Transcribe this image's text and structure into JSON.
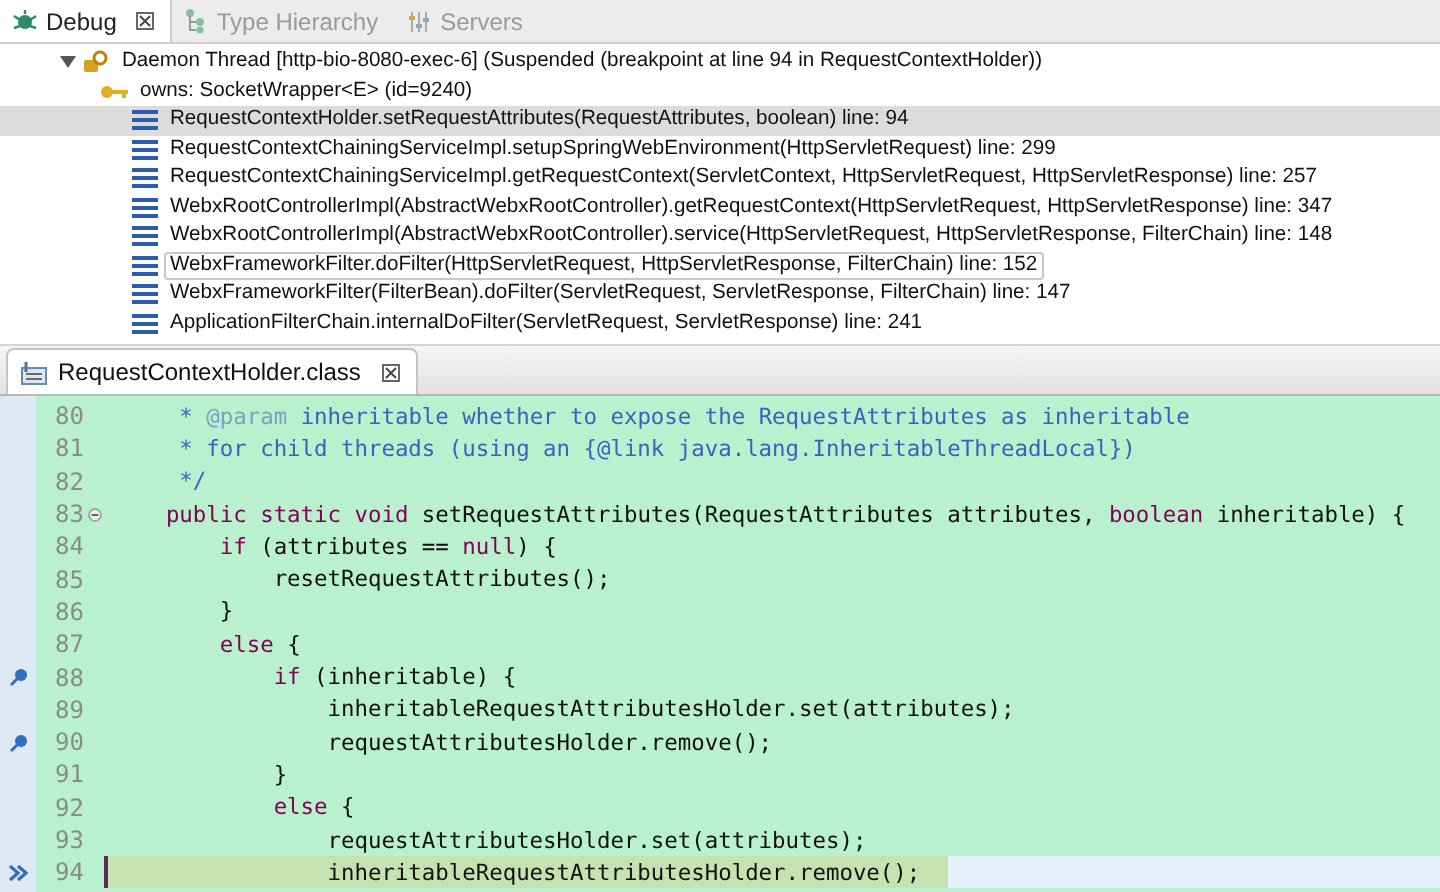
{
  "view_tabs": [
    {
      "label": "Debug",
      "selected": true,
      "closable": true
    },
    {
      "label": "Type Hierarchy",
      "selected": false,
      "closable": false
    },
    {
      "label": "Servers",
      "selected": false,
      "closable": false
    }
  ],
  "debug_tree": {
    "thread": {
      "label": "Daemon Thread [http-bio-8080-exec-6] (Suspended (breakpoint at line 94 in RequestContextHolder))",
      "expanded": true
    },
    "monitor": {
      "label": "owns: SocketWrapper<E>  (id=9240)"
    },
    "frames": [
      {
        "label": "RequestContextHolder.setRequestAttributes(RequestAttributes, boolean) line: 94",
        "selected": true,
        "focused": false
      },
      {
        "label": "RequestContextChainingServiceImpl.setupSpringWebEnvironment(HttpServletRequest) line: 299",
        "selected": false,
        "focused": false
      },
      {
        "label": "RequestContextChainingServiceImpl.getRequestContext(ServletContext, HttpServletRequest, HttpServletResponse) line: 257",
        "selected": false,
        "focused": false
      },
      {
        "label": "WebxRootControllerImpl(AbstractWebxRootController).getRequestContext(HttpServletRequest, HttpServletResponse) line: 347",
        "selected": false,
        "focused": false
      },
      {
        "label": "WebxRootControllerImpl(AbstractWebxRootController).service(HttpServletRequest, HttpServletResponse, FilterChain) line: 148",
        "selected": false,
        "focused": false
      },
      {
        "label": "WebxFrameworkFilter.doFilter(HttpServletRequest, HttpServletResponse, FilterChain) line: 152",
        "selected": false,
        "focused": true
      },
      {
        "label": "WebxFrameworkFilter(FilterBean).doFilter(ServletRequest, ServletResponse, FilterChain) line: 147",
        "selected": false,
        "focused": false
      },
      {
        "label": "ApplicationFilterChain.internalDoFilter(ServletRequest, ServletResponse) line: 241",
        "selected": false,
        "focused": false
      }
    ]
  },
  "editor": {
    "tab": {
      "label": "RequestContextHolder.class",
      "selected": true
    },
    "lines": [
      {
        "number": "80",
        "breakpoint": false,
        "current": false,
        "foldable": false,
        "tokens": [
          {
            "kind": "comment",
            "text": "     * "
          },
          {
            "kind": "doctag",
            "text": "@param"
          },
          {
            "kind": "comment",
            "text": " inheritable whether to expose the RequestAttributes as inheritable"
          }
        ]
      },
      {
        "number": "81",
        "breakpoint": false,
        "current": false,
        "foldable": false,
        "tokens": [
          {
            "kind": "comment",
            "text": "     * for child threads (using an {@link java.lang.InheritableThreadLocal})"
          }
        ]
      },
      {
        "number": "82",
        "breakpoint": false,
        "current": false,
        "foldable": false,
        "tokens": [
          {
            "kind": "comment",
            "text": "     */"
          }
        ]
      },
      {
        "number": "83",
        "breakpoint": false,
        "current": false,
        "foldable": true,
        "tokens": [
          {
            "kind": "keyword",
            "text": "    public static void"
          },
          {
            "kind": "plain",
            "text": " setRequestAttributes(RequestAttributes attributes, "
          },
          {
            "kind": "keyword",
            "text": "boolean"
          },
          {
            "kind": "plain",
            "text": " inheritable) {"
          }
        ]
      },
      {
        "number": "84",
        "breakpoint": false,
        "current": false,
        "foldable": false,
        "tokens": [
          {
            "kind": "keyword",
            "text": "        if"
          },
          {
            "kind": "plain",
            "text": " (attributes == "
          },
          {
            "kind": "keyword",
            "text": "null"
          },
          {
            "kind": "plain",
            "text": ") {"
          }
        ]
      },
      {
        "number": "85",
        "breakpoint": false,
        "current": false,
        "foldable": false,
        "tokens": [
          {
            "kind": "plain",
            "text": "            resetRequestAttributes();"
          }
        ]
      },
      {
        "number": "86",
        "breakpoint": false,
        "current": false,
        "foldable": false,
        "tokens": [
          {
            "kind": "plain",
            "text": "        }"
          }
        ]
      },
      {
        "number": "87",
        "breakpoint": false,
        "current": false,
        "foldable": false,
        "tokens": [
          {
            "kind": "keyword",
            "text": "        else"
          },
          {
            "kind": "plain",
            "text": " {"
          }
        ]
      },
      {
        "number": "88",
        "breakpoint": true,
        "current": false,
        "foldable": false,
        "tokens": [
          {
            "kind": "keyword",
            "text": "            if"
          },
          {
            "kind": "plain",
            "text": " (inheritable) {"
          }
        ]
      },
      {
        "number": "89",
        "breakpoint": false,
        "current": false,
        "foldable": false,
        "tokens": [
          {
            "kind": "plain",
            "text": "                inheritableRequestAttributesHolder.set(attributes);"
          }
        ]
      },
      {
        "number": "90",
        "breakpoint": true,
        "current": false,
        "foldable": false,
        "tokens": [
          {
            "kind": "plain",
            "text": "                requestAttributesHolder.remove();"
          }
        ]
      },
      {
        "number": "91",
        "breakpoint": false,
        "current": false,
        "foldable": false,
        "tokens": [
          {
            "kind": "plain",
            "text": "            }"
          }
        ]
      },
      {
        "number": "92",
        "breakpoint": false,
        "current": false,
        "foldable": false,
        "tokens": [
          {
            "kind": "keyword",
            "text": "            else"
          },
          {
            "kind": "plain",
            "text": " {"
          }
        ]
      },
      {
        "number": "93",
        "breakpoint": false,
        "current": false,
        "foldable": false,
        "tokens": [
          {
            "kind": "plain",
            "text": "                requestAttributesHolder.set(attributes);"
          }
        ]
      },
      {
        "number": "94",
        "breakpoint": false,
        "current": true,
        "foldable": false,
        "tokens": [
          {
            "kind": "plain",
            "text": "                inheritableRequestAttributesHolder.remove();"
          }
        ]
      }
    ]
  }
}
